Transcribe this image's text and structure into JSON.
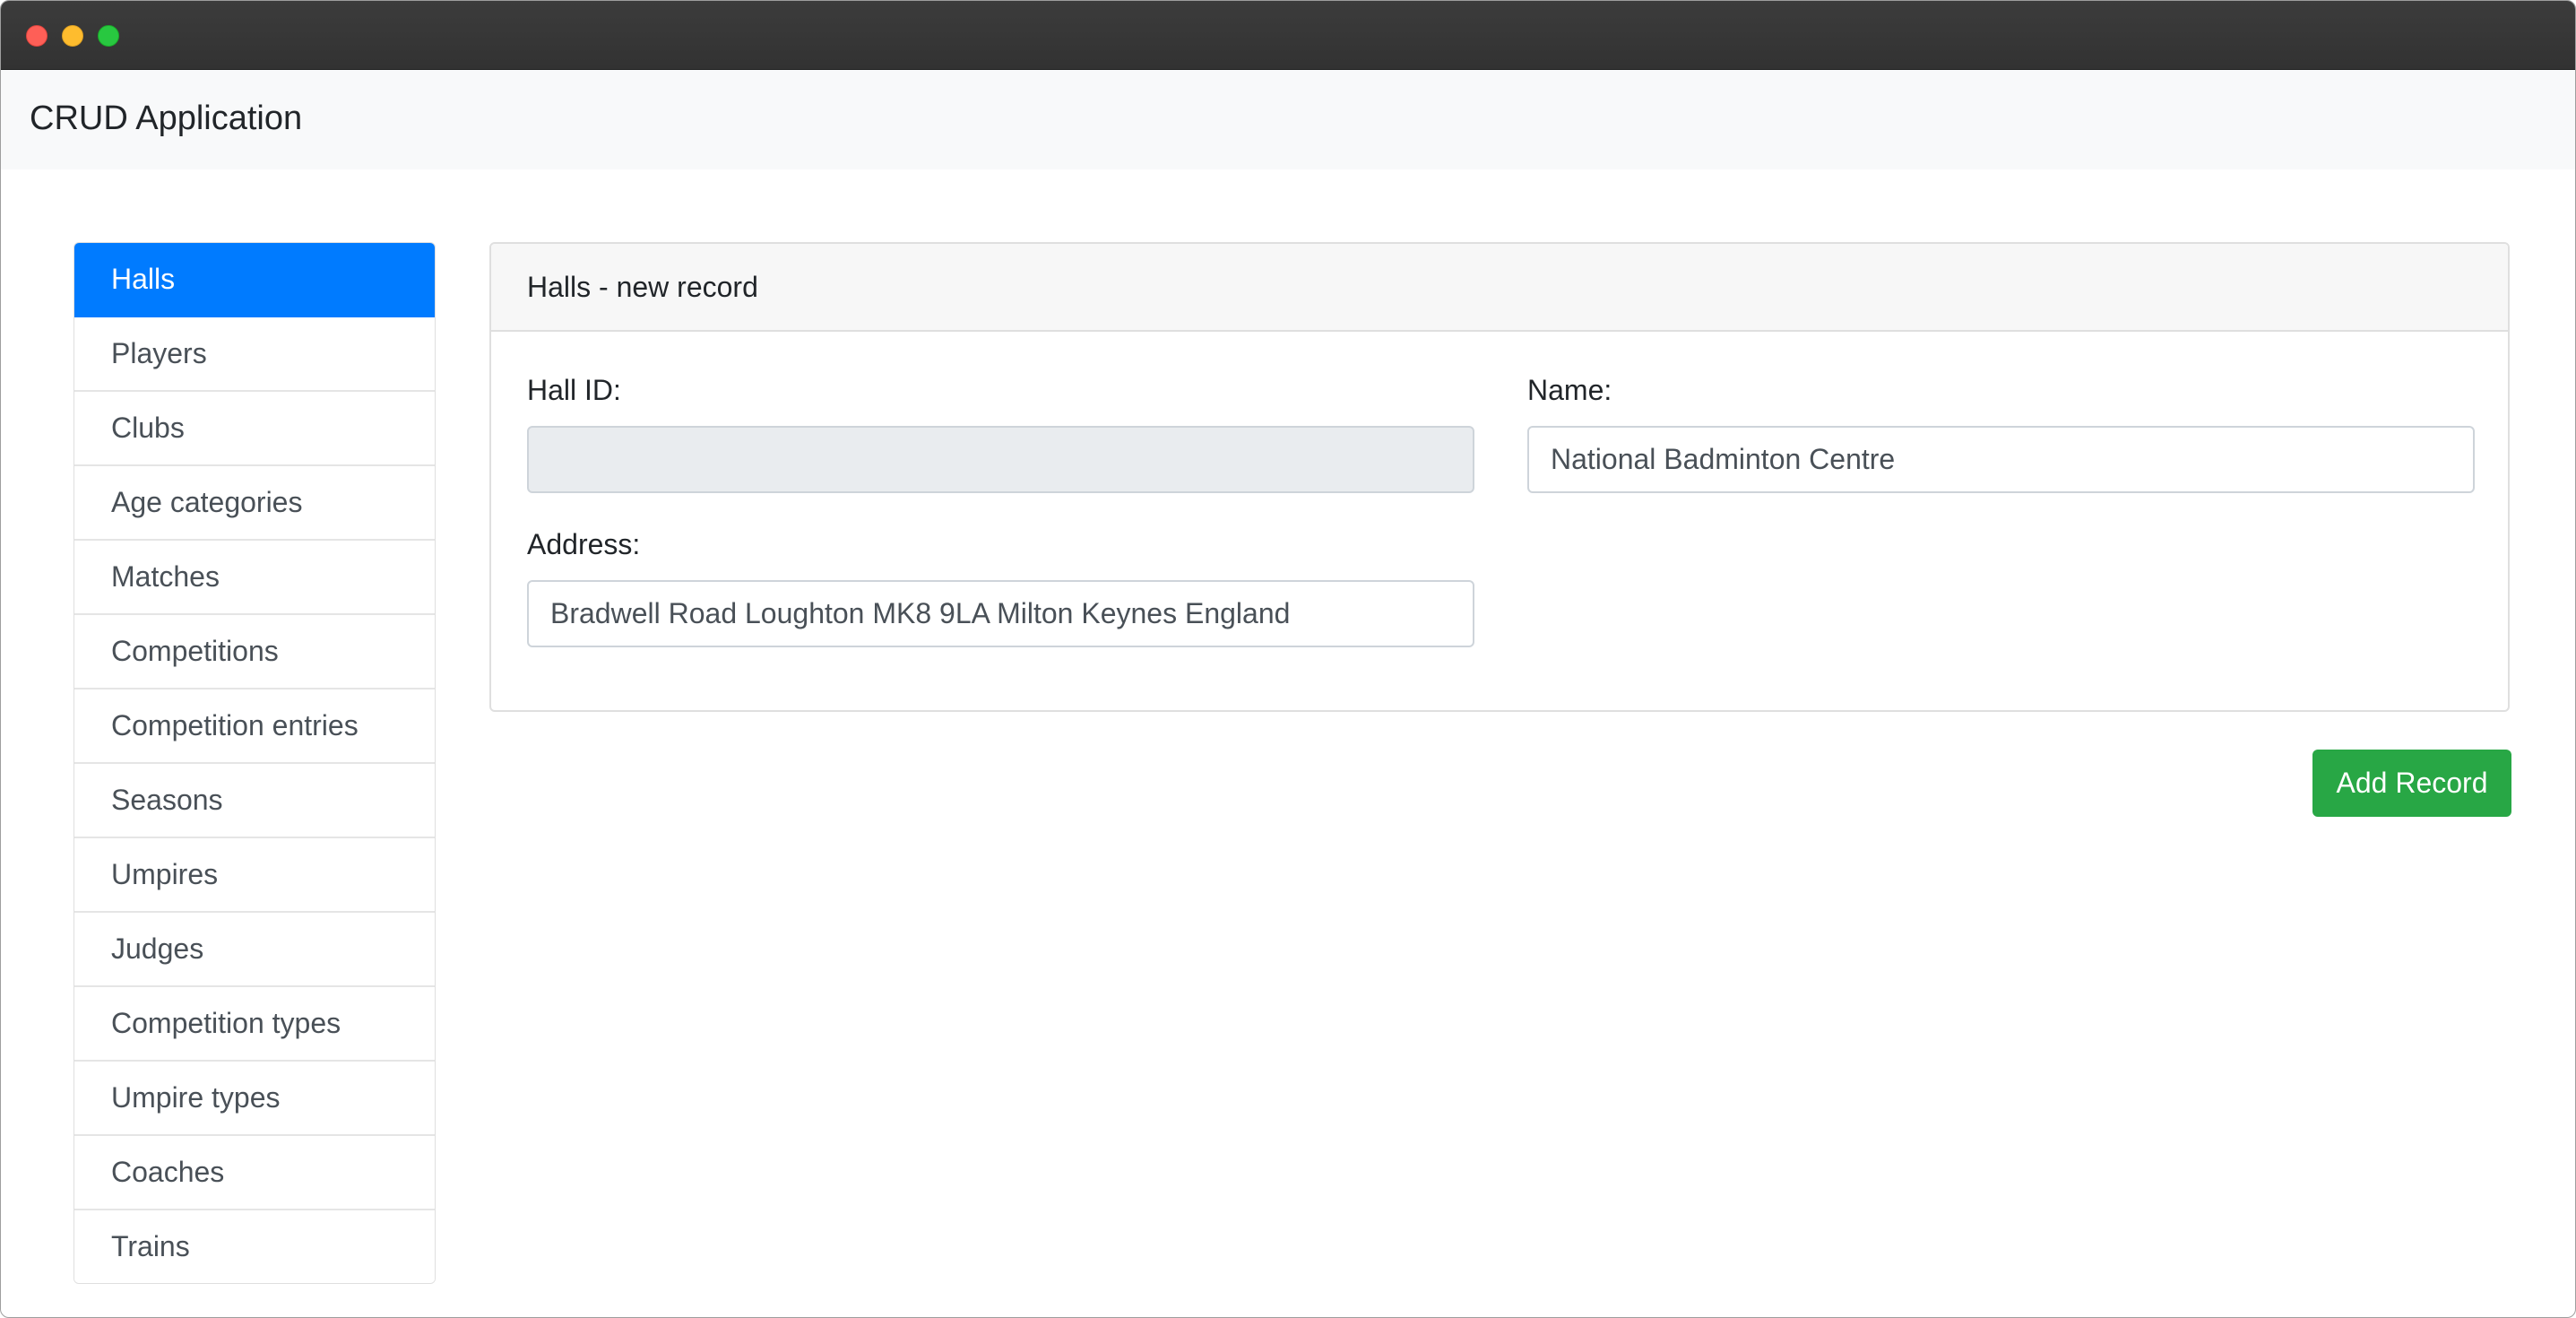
{
  "app": {
    "title": "CRUD Application"
  },
  "sidebar": {
    "items": [
      {
        "label": "Halls",
        "active": true
      },
      {
        "label": "Players"
      },
      {
        "label": "Clubs"
      },
      {
        "label": "Age categories"
      },
      {
        "label": "Matches"
      },
      {
        "label": "Competitions"
      },
      {
        "label": "Competition entries"
      },
      {
        "label": "Seasons"
      },
      {
        "label": "Umpires"
      },
      {
        "label": "Judges"
      },
      {
        "label": "Competition types"
      },
      {
        "label": "Umpire types"
      },
      {
        "label": "Coaches"
      },
      {
        "label": "Trains"
      }
    ]
  },
  "form": {
    "header": "Halls - new record",
    "hall_id": {
      "label": "Hall ID:",
      "value": ""
    },
    "name": {
      "label": "Name:",
      "value": "National Badminton Centre"
    },
    "address": {
      "label": "Address:",
      "value": "Bradwell Road Loughton MK8 9LA Milton Keynes England"
    },
    "submit_label": "Add Record"
  },
  "colors": {
    "active": "#007bff",
    "success": "#28a745",
    "navbar_bg": "#f8f9fa"
  }
}
